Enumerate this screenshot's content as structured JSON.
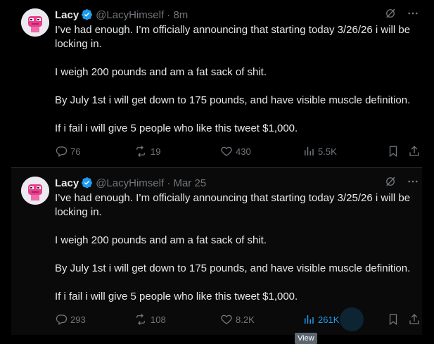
{
  "tweets": [
    {
      "name": "Lacy",
      "handle": "@LacyHimself",
      "separator": "·",
      "time": "8m",
      "paragraphs": [
        "I’ve had enough. I’m officially announcing that starting today 3/26/26 i will be locking in.",
        "I weigh 200 pounds and am a fat sack of shit.",
        "By July 1st i will get down to 175 pounds, and have visible muscle definition.",
        "If i fail i will give 5 people who like this tweet $1,000."
      ],
      "replies": "76",
      "reposts": "19",
      "likes": "430",
      "views": "5.5K"
    },
    {
      "name": "Lacy",
      "handle": "@LacyHimself",
      "separator": "·",
      "time": "Mar 25",
      "paragraphs": [
        "I’ve had enough. I’m officially announcing that starting today 3/25/26 i will be locking in.",
        "I weigh 200 pounds and am a fat sack of shit.",
        "By July 1st i will get down to 175 pounds, and have visible muscle definition.",
        "If i fail i will give 5 people who like this tweet $1,000."
      ],
      "replies": "293",
      "reposts": "108",
      "likes": "8.2K",
      "views": "261K"
    }
  ],
  "tooltip": "View",
  "colors": {
    "accent": "#1d9bf0",
    "muted": "#71767b",
    "text": "#e7e9ea",
    "background": "#000000"
  }
}
